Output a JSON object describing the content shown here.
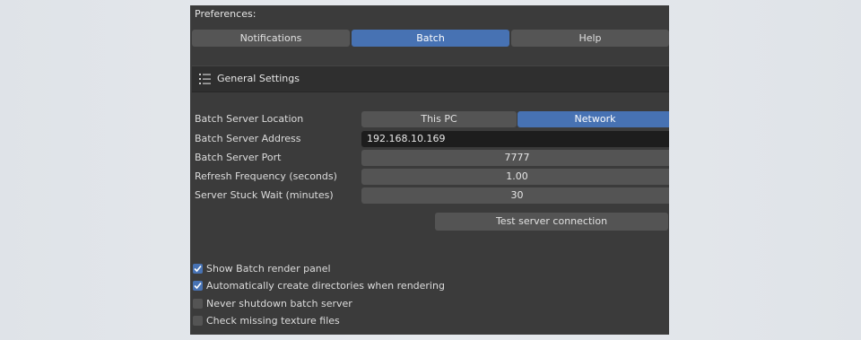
{
  "window": {
    "title": "Preferences:"
  },
  "tabs": [
    {
      "label": "Notifications",
      "active": false
    },
    {
      "label": "Batch",
      "active": true
    },
    {
      "label": "Help",
      "active": false
    }
  ],
  "section": {
    "icon": "list-icon",
    "label": "General Settings"
  },
  "settings": {
    "location": {
      "label": "Batch Server Location",
      "options": [
        "This PC",
        "Network"
      ],
      "selected": "Network"
    },
    "address": {
      "label": "Batch Server Address",
      "value": "192.168.10.169"
    },
    "port": {
      "label": "Batch Server Port",
      "value": "7777"
    },
    "refresh": {
      "label": "Refresh Frequency (seconds)",
      "value": "1.00"
    },
    "stuck": {
      "label": "Server Stuck Wait (minutes)",
      "value": "30"
    }
  },
  "test_button": {
    "label": "Test server connection"
  },
  "checkboxes": [
    {
      "label": "Show Batch render panel",
      "checked": true
    },
    {
      "label": "Automatically create directories when rendering",
      "checked": true
    },
    {
      "label": "Never shutdown batch server",
      "checked": false
    },
    {
      "label": "Check missing texture files",
      "checked": false
    }
  ],
  "colors": {
    "panel": "#3b3b3b",
    "accent": "#4772b3",
    "widget": "#545454",
    "text_field": "#1d1d1d"
  }
}
